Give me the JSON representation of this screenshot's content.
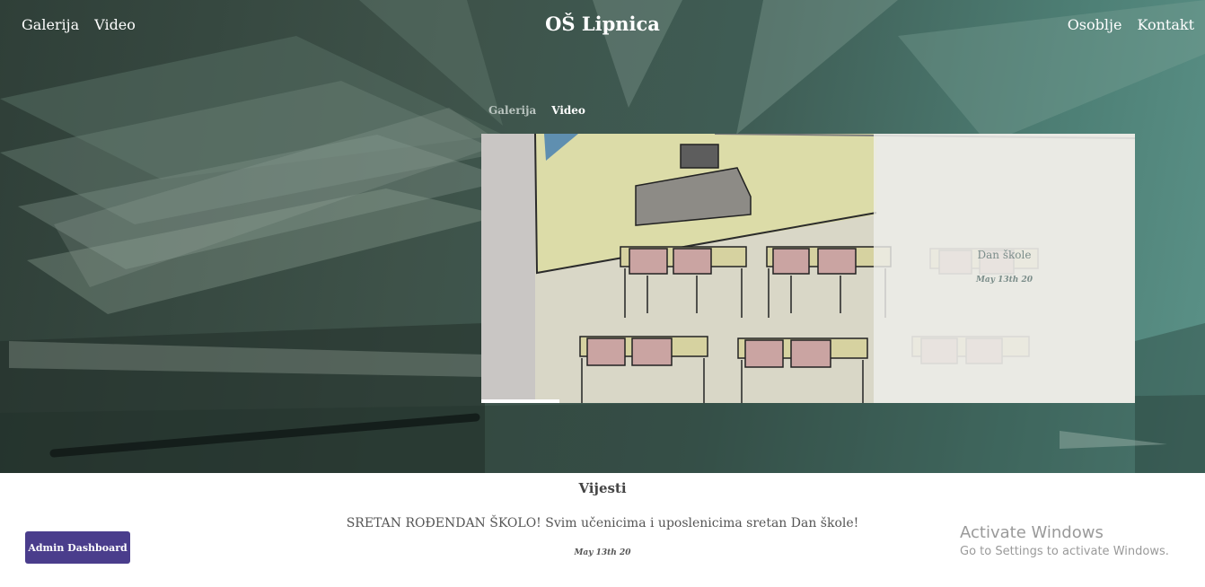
{
  "header": {
    "brand": "OŠ Lipnica",
    "nav_left": [
      "Galerija",
      "Video"
    ],
    "nav_right": [
      "Osoblje",
      "Kontakt"
    ]
  },
  "media_tabs": {
    "gallery": "Galerija",
    "video": "Video",
    "active": "Video"
  },
  "slider": {
    "caption_title": "Dan škole",
    "caption_date": "May 13th 20",
    "progress": 0.12
  },
  "news": {
    "heading": "Vijesti",
    "items": [
      {
        "text": "SRETAN ROĐENDAN ŠKOLO! Svim učenicima i uposlenicima sretan Dan škole!",
        "date": "May 13th 20"
      }
    ]
  },
  "admin": {
    "label": "Admin Dashboard"
  },
  "watermark": {
    "title": "Activate Windows",
    "subtitle": "Go to Settings to activate Windows."
  },
  "colors": {
    "accent": "#4a3d8c",
    "hero_tint": "#3f5d55"
  }
}
